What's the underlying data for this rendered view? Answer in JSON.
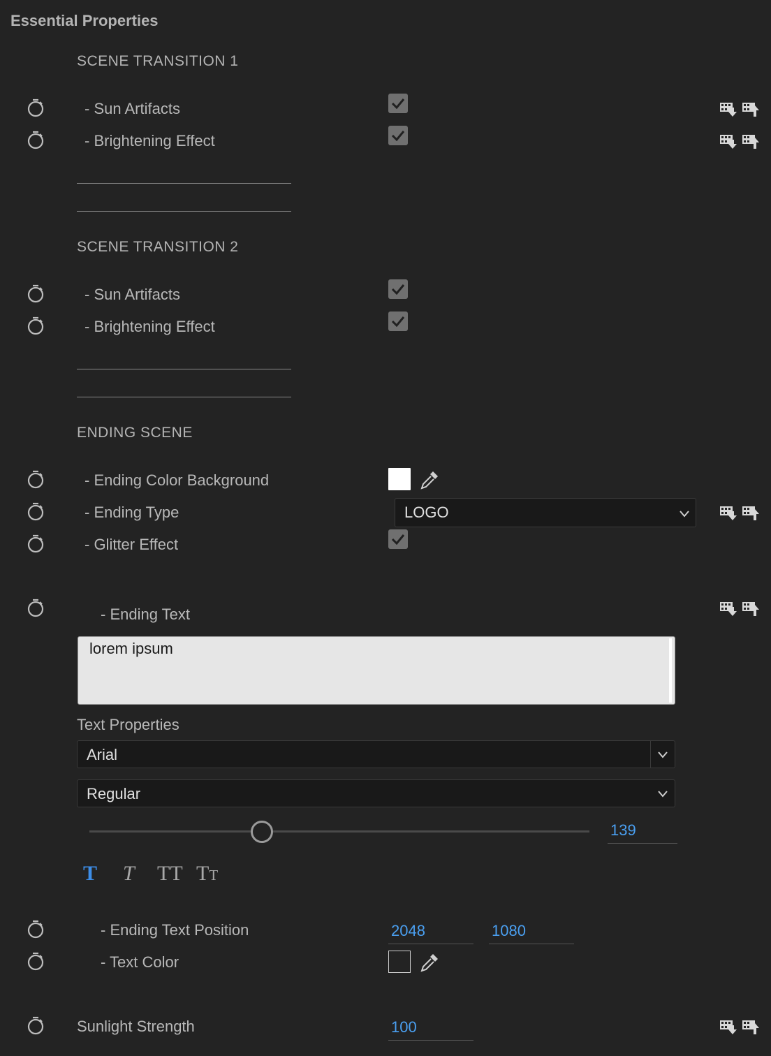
{
  "panel": {
    "title": "Essential Properties"
  },
  "sections": {
    "scene1": {
      "title": "SCENE TRANSITION 1",
      "sun_label": "- Sun Artifacts",
      "sun_checked": true,
      "bright_label": "- Brightening Effect",
      "bright_checked": true
    },
    "scene2": {
      "title": "SCENE TRANSITION 2",
      "sun_label": "- Sun Artifacts",
      "sun_checked": true,
      "bright_label": "- Brightening Effect",
      "bright_checked": true
    },
    "ending": {
      "title": "ENDING SCENE",
      "color_bg_label": "- Ending Color Background",
      "color_bg_value": "#ffffff",
      "type_label": "- Ending Type",
      "type_value": "LOGO",
      "glitter_label": "- Glitter Effect",
      "glitter_checked": true,
      "text_label": "- Ending Text",
      "text_value": "lorem ipsum",
      "text_props_label": "Text Properties",
      "font_family": "Arial",
      "font_style": "Regular",
      "font_size": "139",
      "font_size_fraction": 0.35,
      "text_style_buttons": [
        {
          "name": "faux-bold",
          "glyph": "T",
          "active": true
        },
        {
          "name": "faux-italic",
          "glyph": "T",
          "active": false
        },
        {
          "name": "all-caps",
          "glyph": "TT",
          "active": false
        },
        {
          "name": "small-caps",
          "glyph": "Tт",
          "active": false
        }
      ],
      "position_label": "- Ending Text Position",
      "position_x": "2048",
      "position_y": "1080",
      "text_color_label": "- Text Color",
      "text_color_value": "#232323"
    },
    "sunlight": {
      "label": "Sunlight Strength",
      "value": "100"
    }
  },
  "colors": {
    "background": "#232323",
    "accent_value": "#4a9ff0",
    "active_style": "#3d8ee8"
  },
  "icons": {
    "stopwatch": "stopwatch-icon",
    "keyframe_push": "push-to-graphic-icon",
    "keyframe_pull": "pull-from-graphic-icon",
    "eyedropper": "eyedropper-icon",
    "checkmark": "checkmark-icon",
    "chevron": "chevron-down-icon"
  }
}
